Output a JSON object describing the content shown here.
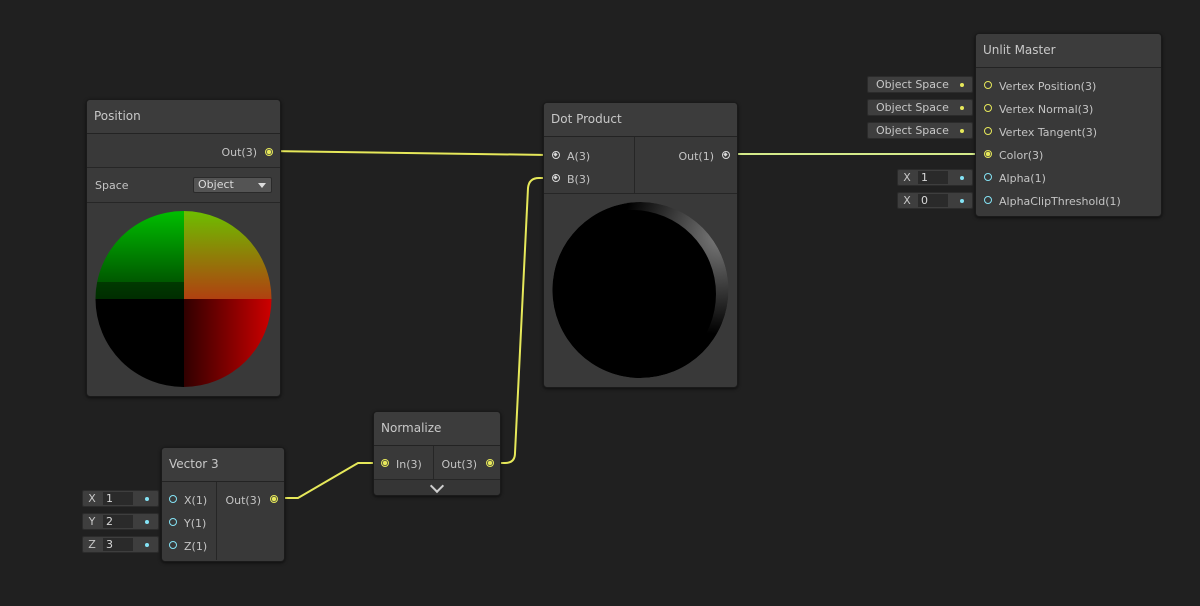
{
  "colors": {
    "background": "#202020",
    "node": "#393939",
    "vector3_wire": "#e6e85a",
    "vector1_wire": "#84e3f5"
  },
  "position_node": {
    "title": "Position",
    "output": "Out(3)",
    "space_label": "Space",
    "space_value": "Object"
  },
  "dot_node": {
    "title": "Dot Product",
    "input_a": "A(3)",
    "input_b": "B(3)",
    "output": "Out(1)"
  },
  "normalize_node": {
    "title": "Normalize",
    "input": "In(3)",
    "output": "Out(3)"
  },
  "vector3_node": {
    "title": "Vector 3",
    "inputs": [
      {
        "label": "X(1)",
        "axis": "X",
        "value": "1"
      },
      {
        "label": "Y(1)",
        "axis": "Y",
        "value": "2"
      },
      {
        "label": "Z(1)",
        "axis": "Z",
        "value": "3"
      }
    ],
    "output": "Out(3)"
  },
  "master_node": {
    "title": "Unlit Master",
    "ports": [
      {
        "label": "Vertex Position(3)",
        "field": "Object Space"
      },
      {
        "label": "Vertex Normal(3)",
        "field": "Object Space"
      },
      {
        "label": "Vertex Tangent(3)",
        "field": "Object Space"
      },
      {
        "label": "Color(3)"
      },
      {
        "label": "Alpha(1)",
        "axis": "X",
        "value": "1"
      },
      {
        "label": "AlphaClipThreshold(1)",
        "axis": "X",
        "value": "0"
      }
    ]
  }
}
